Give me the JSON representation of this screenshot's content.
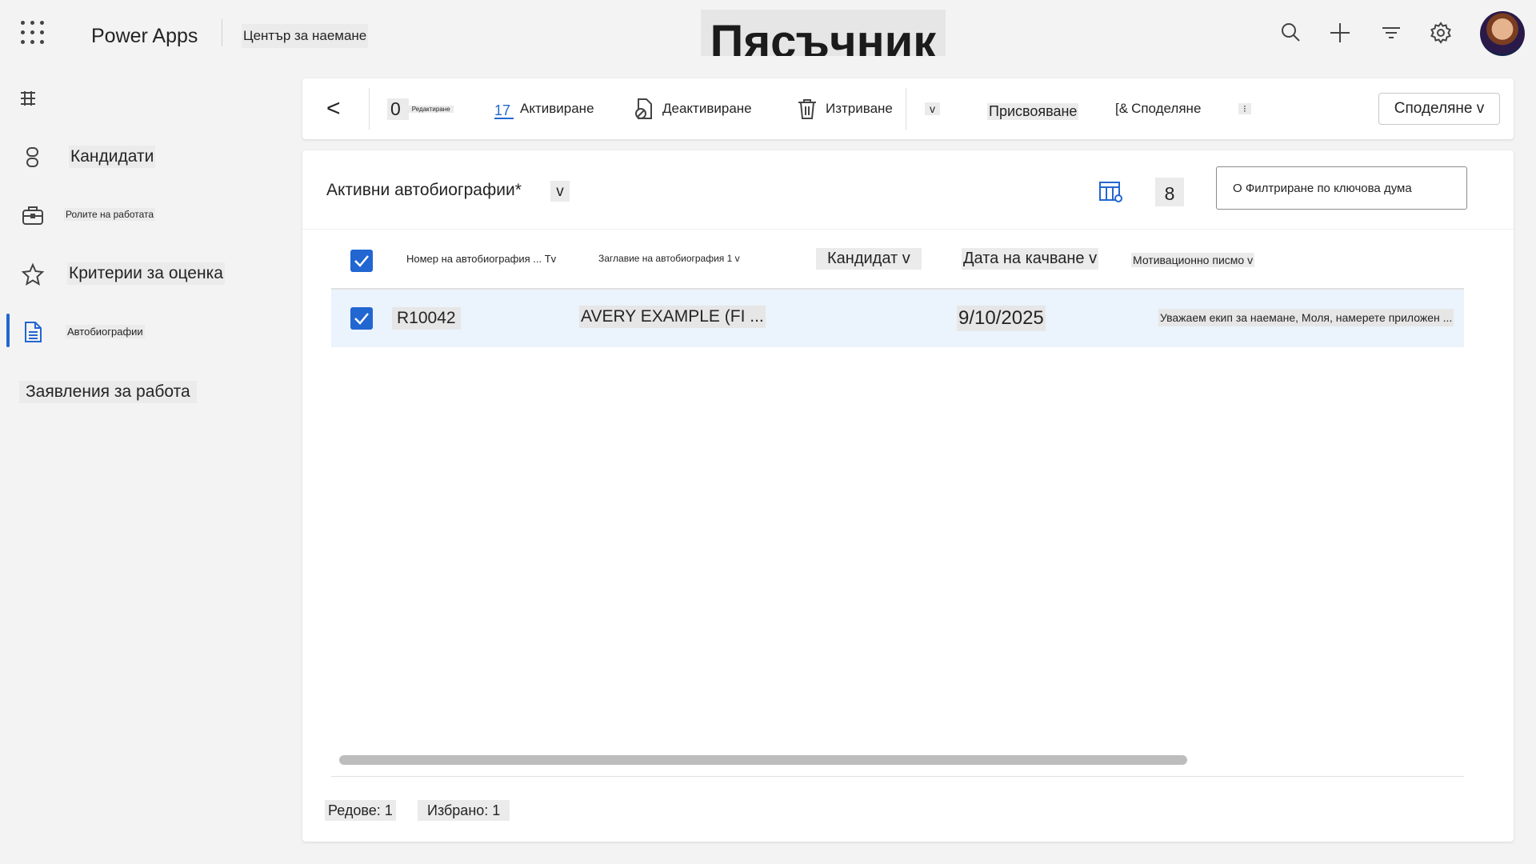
{
  "topbar": {
    "app_name": "Power Apps",
    "module_name": "Център за наемане",
    "environment_title": "Пясъчник",
    "icons": [
      "waffle-icon",
      "search-icon",
      "plus-icon",
      "filter-icon",
      "gear-icon",
      "avatar"
    ]
  },
  "sidebar": {
    "items": [
      {
        "label": "Кандидати",
        "icon": "people-icon"
      },
      {
        "label": "Ролите на работата",
        "icon": "briefcase-icon"
      },
      {
        "label": "Критерии за оценка",
        "icon": "star-icon"
      },
      {
        "label": "Автобиографии",
        "icon": "document-icon",
        "active": true
      },
      {
        "label": "Заявления за работа",
        "icon": ""
      }
    ]
  },
  "commandbar": {
    "back": "<",
    "edit_count": "0",
    "edit_label": "Редактиране",
    "activate_num": "17",
    "activate": "Активиране",
    "deactivate": "Деактивиране",
    "delete": "Изтриване",
    "more_chevron": "v",
    "assign": "Присвояване",
    "share_prefix": "[&",
    "share": "Споделяне",
    "overflow": "⁝",
    "share_button": "Споделяне v"
  },
  "view": {
    "title": "Активни автобиографии*",
    "chevron": "v",
    "record_count": "8",
    "filter_placeholder": "О Филтриране по ключова дума"
  },
  "table": {
    "columns": [
      "Номер на автобиография ... Tv",
      "Заглавие на автобиография 1 v",
      "Кандидат v",
      "Дата на качване v",
      "Мотивационно писмо v"
    ],
    "rows": [
      {
        "selected": true,
        "number": "R10042",
        "title": "AVERY EXAMPLE (FI ...",
        "candidate": "",
        "upload_date": "9/10/2025",
        "cover_letter": "Уважаем екип за наемане, Моля, намерете приложен ..."
      }
    ]
  },
  "footer": {
    "rows": "Редове: 1",
    "selected": "Избрано: 1"
  },
  "colors": {
    "accent": "#2266d1",
    "selected_row": "#ebf3fc",
    "background": "#f3f3f3"
  }
}
